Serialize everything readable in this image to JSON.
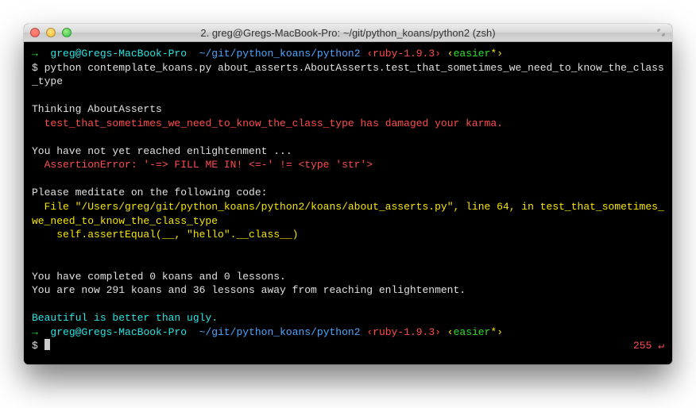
{
  "window": {
    "title": "2. greg@Gregs-MacBook-Pro: ~/git/python_koans/python2 (zsh)"
  },
  "prompt": {
    "arrow": "→",
    "host": "greg@Gregs-MacBook-Pro",
    "path": "~/git/python_koans/python2",
    "rvm_open": "‹",
    "rvm": "ruby-1.9.3",
    "rvm_close": "›",
    "git_open": "‹",
    "git_branch": "easier",
    "git_dirty": "*",
    "git_close": "›",
    "ps1": "$"
  },
  "cmd1": "python contemplate_koans.py about_asserts.AboutAsserts.test_that_sometimes_we_need_to_know_the_class_type",
  "output": {
    "thinking": "Thinking AboutAsserts",
    "karma_test": "  test_that_sometimes_we_need_to_know_the_class_type",
    "karma_msg": " has damaged your karma.",
    "not_enlightened": "You have not yet reached enlightenment ...",
    "assertion": "  AssertionError: '-=> FILL ME IN! <=-' != <type 'str'>",
    "meditate": "Please meditate on the following code:",
    "file_line": "  File \"/Users/greg/git/python_koans/python2/koans/about_asserts.py\", line 64, in test_that_sometimes_we_need_to_know_the_class_type",
    "code_line": "    self.assertEqual(__, \"hello\".__class__)",
    "completed": "You have completed 0 koans and 0 lessons.",
    "remaining": "You are now 291 koans and 36 lessons away from reaching enlightenment.",
    "zen": "Beautiful is better than ugly."
  },
  "status": {
    "code": "255",
    "ret": "↵"
  }
}
